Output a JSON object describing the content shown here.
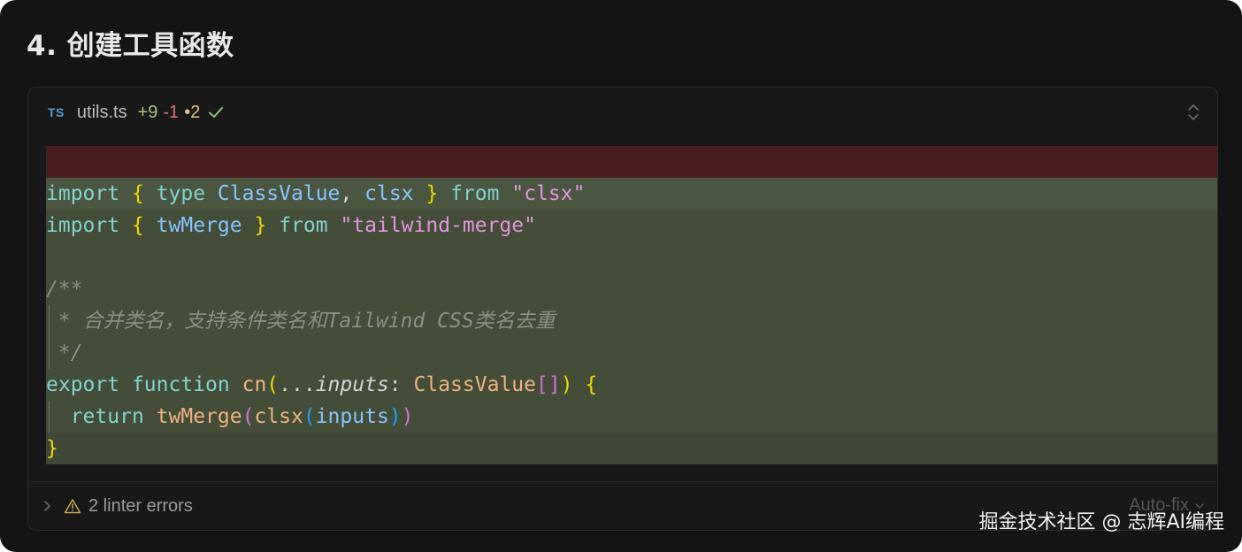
{
  "heading": "4. 创建工具函数",
  "file": {
    "icon": "TS",
    "name": "utils.ts",
    "additions": "+9",
    "deletions": "-1",
    "modifications": "•2"
  },
  "code": {
    "line1": {
      "kw1": "import",
      "b1": "{",
      "t1": "type",
      "t2": "ClassValue",
      "comma": ",",
      "t3": "clsx",
      "b2": "}",
      "kw2": "from",
      "s": "\"clsx\""
    },
    "line2": {
      "kw1": "import",
      "b1": "{",
      "t1": "twMerge",
      "b2": "}",
      "kw2": "from",
      "s": "\"tailwind-merge\""
    },
    "comment_open": "/**",
    "comment_body": " * 合并类名，支持条件类名和Tailwind CSS类名去重",
    "comment_close": " */",
    "line_fn": {
      "kw1": "export",
      "kw2": "function",
      "fn": "cn",
      "p1": "(",
      "spread": "...",
      "param": "inputs",
      "colon": ":",
      "ty": "ClassValue",
      "arr": "[]",
      "p2": ")",
      "b": "{"
    },
    "line_ret": {
      "kw": "return",
      "f1": "twMerge",
      "p1": "(",
      "f2": "clsx",
      "p2": "(",
      "arg": "inputs",
      "p3": ")",
      "p4": ")"
    },
    "close": "}"
  },
  "footer": {
    "lint": "2 linter errors",
    "autofix": "Auto-fix"
  },
  "watermark": "掘金技术社区 @ 志辉AI编程",
  "colors": {
    "background": "#141414",
    "removed_line": "#4a1e1e",
    "added_line": "#434d38",
    "keyword": "#82d2ce",
    "string": "#e394dc"
  }
}
